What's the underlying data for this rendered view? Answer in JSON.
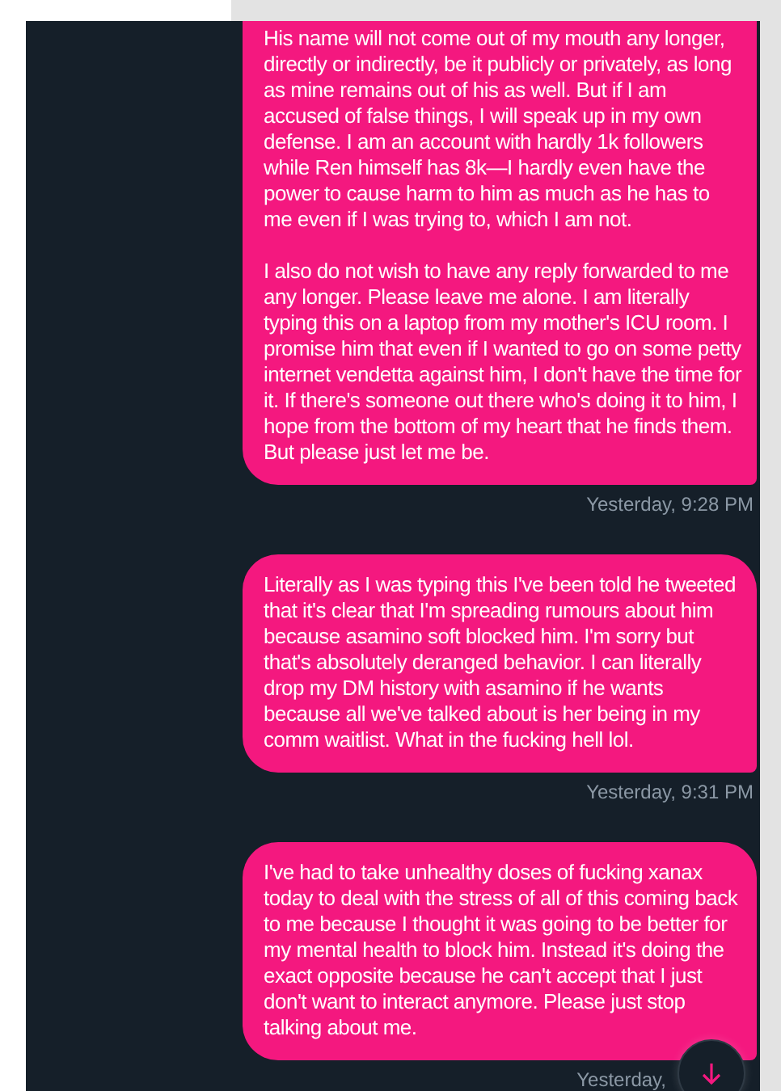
{
  "messages": [
    {
      "paragraphs": [
        "His name will not come out of my mouth any longer, directly or indirectly, be it publicly or privately, as long as mine remains out of his as well. But if I am accused of false things, I will speak up in my own defense. I am an account with hardly 1k followers while Ren himself has 8k—I hardly even have the power to cause harm to him as much as he has to me even if I was trying to, which I am not.",
        "I also do not wish to have any reply forwarded to me any longer. Please leave me alone. I am literally typing this on a laptop from my mother's ICU room. I promise him that even if I wanted to go on some petty internet vendetta against him, I don't have the time for it. If there's someone out there who's doing it to him, I hope from the bottom of my heart that he finds them. But please just let me be."
      ],
      "time": "Yesterday, 9:28 PM"
    },
    {
      "paragraphs": [
        "Literally as I was typing this I've been told he tweeted that it's clear that I'm spreading rumours about him because asamino soft blocked him. I'm sorry but that's absolutely deranged behavior. I can literally drop my DM history with asamino if he wants because all we've talked about is her being in my comm waitlist. What in the fucking hell lol."
      ],
      "time": "Yesterday, 9:31 PM"
    },
    {
      "paragraphs": [
        "I've had to take unhealthy doses of fucking xanax today to deal with the stress of all of this coming back to me because I thought it was going to be better for my mental health to block him. Instead it's doing the exact opposite because he can't accept that I just don't want to interact anymore. Please just stop talking about me."
      ],
      "time": "Yesterday,"
    }
  ]
}
